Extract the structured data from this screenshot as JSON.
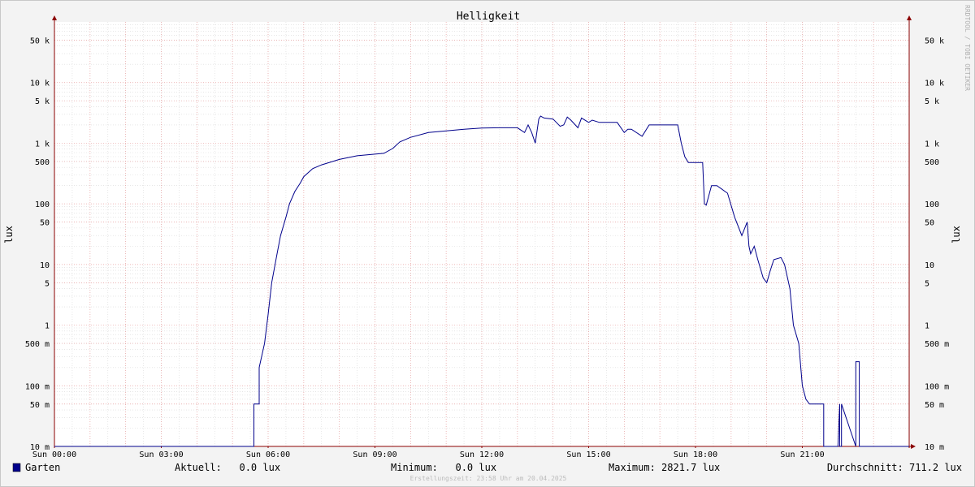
{
  "chart_data": {
    "type": "line",
    "title": "Helligkeit",
    "ylabel": "lux",
    "y_scale": "log",
    "ylim": [
      0.01,
      100000
    ],
    "x_tick_labels": [
      "Sun 00:00",
      "Sun 03:00",
      "Sun 06:00",
      "Sun 09:00",
      "Sun 12:00",
      "Sun 15:00",
      "Sun 18:00",
      "Sun 21:00"
    ],
    "x_unit": "hours",
    "xlim": [
      0,
      24
    ],
    "y_ticks": [
      {
        "value": 50000,
        "label": "50 k"
      },
      {
        "value": 10000,
        "label": "10 k"
      },
      {
        "value": 5000,
        "label": "5 k"
      },
      {
        "value": 1000,
        "label": "1 k"
      },
      {
        "value": 500,
        "label": "500"
      },
      {
        "value": 100,
        "label": "100"
      },
      {
        "value": 50,
        "label": "50"
      },
      {
        "value": 10,
        "label": "10"
      },
      {
        "value": 5,
        "label": "5"
      },
      {
        "value": 1,
        "label": "1"
      },
      {
        "value": 0.5,
        "label": "500 m"
      },
      {
        "value": 0.1,
        "label": "100 m"
      },
      {
        "value": 0.05,
        "label": "50 m"
      },
      {
        "value": 0.01,
        "label": "10 m"
      }
    ],
    "grid": true,
    "series": [
      {
        "name": "Garten",
        "color": "#00008b",
        "x": [
          0,
          5.6,
          5.6,
          5.75,
          5.75,
          5.9,
          6.0,
          6.1,
          6.25,
          6.35,
          6.5,
          6.6,
          6.75,
          6.9,
          7.0,
          7.25,
          7.5,
          8.0,
          8.5,
          9.0,
          9.25,
          9.5,
          9.7,
          10.0,
          10.5,
          11.0,
          11.5,
          12.0,
          12.5,
          13.0,
          13.2,
          13.3,
          13.4,
          13.5,
          13.6,
          13.65,
          13.75,
          14.0,
          14.2,
          14.3,
          14.4,
          14.5,
          14.7,
          14.8,
          15.0,
          15.1,
          15.3,
          15.5,
          15.8,
          16.0,
          16.1,
          16.2,
          16.5,
          16.7,
          17.0,
          17.5,
          17.6,
          17.7,
          17.8,
          18.2,
          18.25,
          18.3,
          18.45,
          18.6,
          18.9,
          19.1,
          19.3,
          19.45,
          19.5,
          19.55,
          19.65,
          19.75,
          19.9,
          20.0,
          20.1,
          20.2,
          20.4,
          20.5,
          20.65,
          20.75,
          20.9,
          21.0,
          21.1,
          21.2,
          21.3,
          21.45,
          21.55,
          21.6,
          21.6,
          22.0,
          22.05,
          22.05,
          22.1,
          22.1,
          22.5,
          22.5,
          22.6,
          22.6,
          24
        ],
        "y": [
          0.01,
          0.01,
          0.05,
          0.05,
          0.2,
          0.5,
          1.5,
          5,
          15,
          30,
          60,
          100,
          160,
          220,
          280,
          380,
          440,
          540,
          620,
          660,
          680,
          820,
          1050,
          1250,
          1500,
          1600,
          1700,
          1780,
          1800,
          1800,
          1500,
          2000,
          1500,
          1000,
          2500,
          2800,
          2600,
          2500,
          1900,
          2000,
          2700,
          2400,
          1800,
          2600,
          2200,
          2400,
          2200,
          2200,
          2200,
          1500,
          1700,
          1700,
          1300,
          2000,
          2000,
          2000,
          1000,
          600,
          480,
          480,
          100,
          95,
          200,
          200,
          150,
          60,
          30,
          50,
          20,
          15,
          20,
          12,
          6,
          5,
          8,
          12,
          13,
          10,
          4,
          1,
          0.5,
          0.1,
          0.06,
          0.05,
          0.05,
          0.05,
          0.05,
          0.05,
          0.01,
          0.01,
          0.05,
          0.01,
          0.01,
          0.05,
          0.01,
          0.25,
          0.25,
          0.01,
          0.01
        ]
      }
    ]
  },
  "legend": {
    "series_name": "Garten",
    "aktuell": "Aktuell:   0.0 lux",
    "minimum": "Minimum:   0.0 lux",
    "maximum": "Maximum: 2821.7 lux",
    "average": "Durchschnitt: 711.2 lux"
  },
  "footer": "Erstellungszeit: 23:58 Uhr am 20.04.2025",
  "side_text": "RRDTOOL / TOBI OETIKER",
  "colors": {
    "background": "#f3f3f3",
    "plot_background": "#ffffff",
    "line": "#00008b",
    "grid_major": "#e8a0a0",
    "grid_minor": "#d8d8d8",
    "axis_arrow": "#8b0000"
  }
}
